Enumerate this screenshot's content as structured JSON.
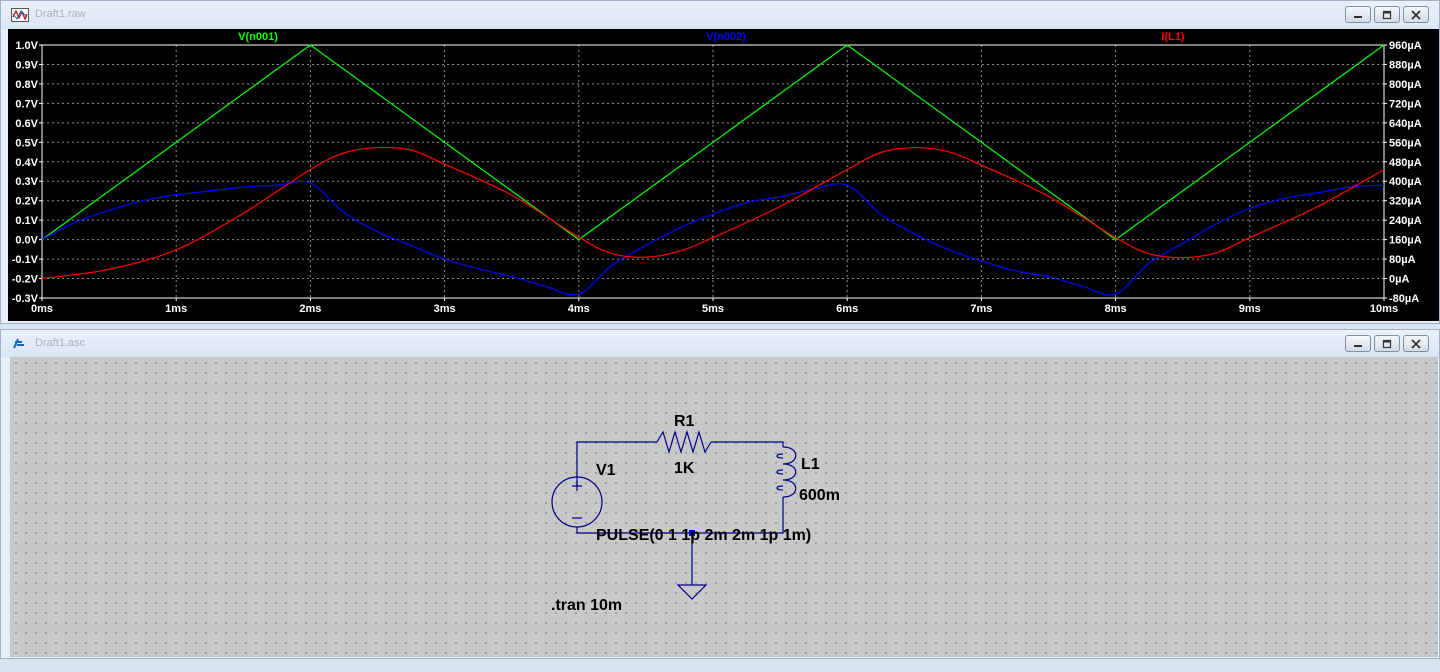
{
  "plot_window": {
    "title": "Draft1.raw",
    "chart_data": {
      "type": "line",
      "x_ticks": [
        "0ms",
        "1ms",
        "2ms",
        "3ms",
        "4ms",
        "5ms",
        "6ms",
        "7ms",
        "8ms",
        "9ms",
        "10ms"
      ],
      "xlim": [
        0,
        10
      ],
      "left_ticks": [
        "1.0V",
        "0.9V",
        "0.8V",
        "0.7V",
        "0.6V",
        "0.5V",
        "0.4V",
        "0.3V",
        "0.2V",
        "0.1V",
        "0.0V",
        "-0.1V",
        "-0.2V",
        "-0.3V"
      ],
      "left_ylim": [
        -0.3,
        1.0
      ],
      "right_ticks": [
        "960µA",
        "880µA",
        "800µA",
        "720µA",
        "640µA",
        "560µA",
        "480µA",
        "400µA",
        "320µA",
        "240µA",
        "160µA",
        "80µA",
        "0µA",
        "-80µA"
      ],
      "right_ylim": [
        -80,
        960
      ],
      "grid": true,
      "colors": {
        "V(n001)": "#00ff00",
        "V(n002)": "#0000ff",
        "I(L1)": "#ff0000"
      },
      "series": [
        {
          "name": "V(n001)",
          "axis": "left",
          "points": [
            [
              0,
              0
            ],
            [
              2,
              1.0
            ],
            [
              4,
              0
            ],
            [
              6,
              1.0
            ],
            [
              8,
              0
            ],
            [
              10,
              1.0
            ]
          ]
        },
        {
          "name": "V(n002)",
          "axis": "left",
          "points": [
            [
              0,
              0
            ],
            [
              0.25,
              0.09
            ],
            [
              0.5,
              0.15
            ],
            [
              0.75,
              0.2
            ],
            [
              1,
              0.23
            ],
            [
              1.25,
              0.25
            ],
            [
              1.5,
              0.27
            ],
            [
              1.75,
              0.28
            ],
            [
              2,
              0.29
            ],
            [
              2.25,
              0.14
            ],
            [
              2.5,
              0.04
            ],
            [
              2.75,
              -0.03
            ],
            [
              3,
              -0.1
            ],
            [
              3.25,
              -0.15
            ],
            [
              3.5,
              -0.19
            ],
            [
              3.75,
              -0.24
            ],
            [
              4,
              -0.28
            ],
            [
              4.25,
              -0.13
            ],
            [
              4.5,
              -0.03
            ],
            [
              4.75,
              0.06
            ],
            [
              5,
              0.13
            ],
            [
              5.25,
              0.19
            ],
            [
              5.5,
              0.22
            ],
            [
              5.75,
              0.26
            ],
            [
              6,
              0.28
            ],
            [
              6.25,
              0.13
            ],
            [
              6.5,
              0.03
            ],
            [
              6.75,
              -0.05
            ],
            [
              7,
              -0.11
            ],
            [
              7.25,
              -0.16
            ],
            [
              7.5,
              -0.19
            ],
            [
              7.75,
              -0.24
            ],
            [
              8,
              -0.28
            ],
            [
              8.25,
              -0.12
            ],
            [
              8.5,
              -0.02
            ],
            [
              8.75,
              0.08
            ],
            [
              9,
              0.16
            ],
            [
              9.25,
              0.21
            ],
            [
              9.5,
              0.24
            ],
            [
              9.75,
              0.27
            ],
            [
              10,
              0.28
            ]
          ]
        },
        {
          "name": "I(L1)",
          "axis": "right",
          "points": [
            [
              0,
              0
            ],
            [
              0.5,
              38
            ],
            [
              1,
              118
            ],
            [
              1.5,
              268
            ],
            [
              2,
              448
            ],
            [
              2.25,
              516
            ],
            [
              2.5,
              538
            ],
            [
              2.75,
              528
            ],
            [
              3,
              470
            ],
            [
              3.5,
              343
            ],
            [
              4,
              170
            ],
            [
              4.25,
              102
            ],
            [
              4.5,
              88
            ],
            [
              4.75,
              112
            ],
            [
              5,
              168
            ],
            [
              5.5,
              296
            ],
            [
              6,
              448
            ],
            [
              6.25,
              518
            ],
            [
              6.5,
              538
            ],
            [
              6.75,
              522
            ],
            [
              7,
              466
            ],
            [
              7.5,
              338
            ],
            [
              8,
              168
            ],
            [
              8.25,
              102
            ],
            [
              8.5,
              86
            ],
            [
              8.75,
              106
            ],
            [
              9,
              168
            ],
            [
              9.5,
              294
            ],
            [
              10,
              448
            ]
          ]
        }
      ]
    }
  },
  "schematic_window": {
    "title": "Draft1.asc",
    "components": {
      "r1": {
        "name": "R1",
        "value": "1K"
      },
      "l1": {
        "name": "L1",
        "value": "600m"
      },
      "v1": {
        "name": "V1",
        "value": "PULSE(0 1 1p 2m 2m 1p 1m)"
      }
    },
    "directive": ".tran 10m"
  }
}
